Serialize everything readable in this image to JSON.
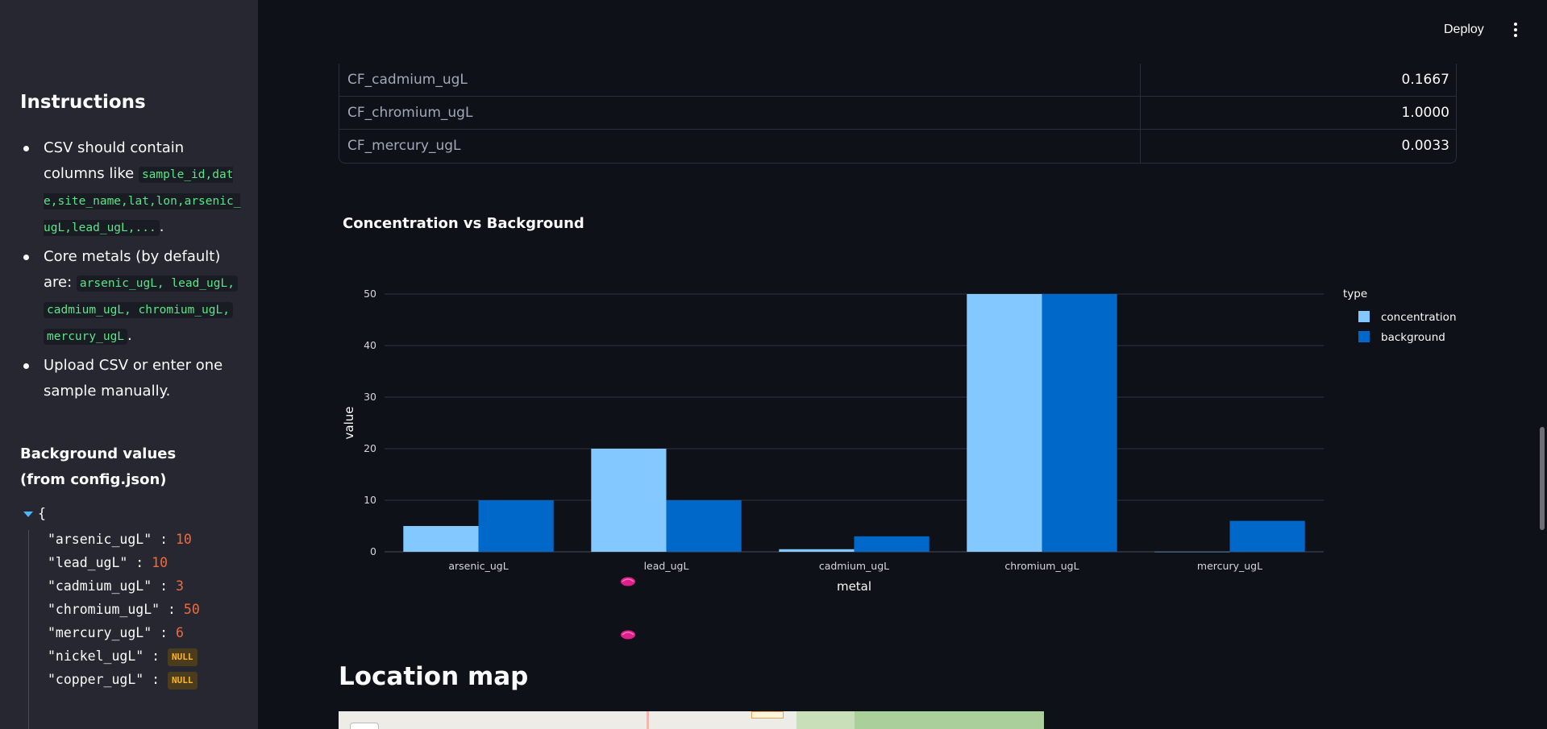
{
  "sidebar": {
    "instructions_title": "Instructions",
    "bullet1_text": "CSV should contain columns like ",
    "bullet1_code": "sample_id,date,site_name,lat,lon,arsenic_ugL,lead_ugL,...",
    "bullet1_end": ".",
    "bullet2_text": "Core metals (by default) are: ",
    "bullet2_code1": "arsenic_ugL, lead_ugL,",
    "bullet2_code2": "cadmium_ugL, chromium_ugL,",
    "bullet2_code3": "mercury_ugL",
    "bullet2_end": ".",
    "bullet3_text": "Upload CSV or enter one sample manually.",
    "background_title": "Background values (from config.json)",
    "json_open": "{",
    "json": [
      {
        "key": "\"arsenic_ugL\"",
        "value": "10"
      },
      {
        "key": "\"lead_ugL\"",
        "value": "10"
      },
      {
        "key": "\"cadmium_ugL\"",
        "value": "3"
      },
      {
        "key": "\"chromium_ugL\"",
        "value": "50"
      },
      {
        "key": "\"mercury_ugL\"",
        "value": "6"
      },
      {
        "key": "\"nickel_ugL\"",
        "value": "NULL"
      },
      {
        "key": "\"copper_ugL\"",
        "value": "NULL"
      }
    ]
  },
  "header": {
    "deploy_label": "Deploy"
  },
  "table": {
    "rows": [
      {
        "name": "CF_cadmium_ugL",
        "value": "0.1667"
      },
      {
        "name": "CF_chromium_ugL",
        "value": "1.0000"
      },
      {
        "name": "CF_mercury_ugL",
        "value": "0.0033"
      }
    ]
  },
  "chart_data": {
    "type": "bar",
    "title": "Concentration vs Background",
    "xlabel": "metal",
    "ylabel": "value",
    "categories": [
      "arsenic_ugL",
      "lead_ugL",
      "cadmium_ugL",
      "chromium_ugL",
      "mercury_ugL"
    ],
    "series": [
      {
        "name": "concentration",
        "values": [
          5,
          20,
          0.5,
          50,
          0.02
        ],
        "color": "#83c9ff"
      },
      {
        "name": "background",
        "values": [
          10,
          10,
          3,
          50,
          6
        ],
        "color": "#0068c9"
      }
    ],
    "ylim": [
      0,
      50
    ],
    "yticks": [
      0,
      10,
      20,
      30,
      40,
      50
    ],
    "legend_title": "type",
    "legend_position": "top-right",
    "grid": true
  },
  "map": {
    "title": "Location map"
  }
}
